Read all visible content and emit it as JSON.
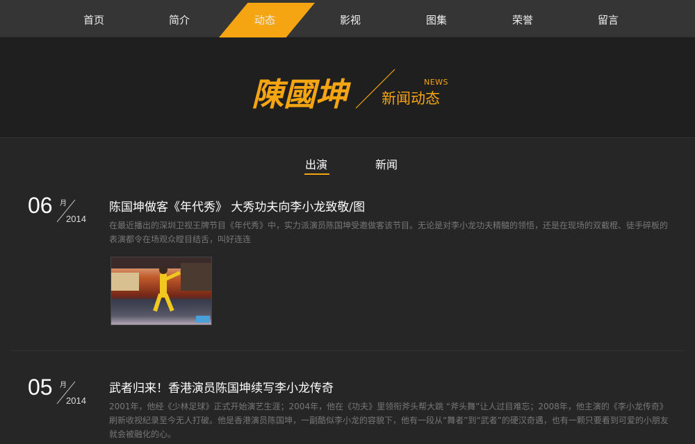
{
  "nav": {
    "items": [
      {
        "label": "首页"
      },
      {
        "label": "简介"
      },
      {
        "label": "动态",
        "active": true
      },
      {
        "label": "影视"
      },
      {
        "label": "图集"
      },
      {
        "label": "荣誉"
      },
      {
        "label": "留言"
      }
    ]
  },
  "header": {
    "logo_text": "陳國坤",
    "news_en": "NEWS",
    "news_cn": "新闻动态"
  },
  "tabs": [
    {
      "label": "出演",
      "active": true
    },
    {
      "label": "新闻",
      "active": false
    }
  ],
  "articles": [
    {
      "day": "06",
      "month_label": "月",
      "year": "2014",
      "title": "陈国坤做客《年代秀》 大秀功夫向李小龙致敬/图",
      "excerpt": "在最近播出的深圳卫视王牌节目《年代秀》中，实力派演员陈国坤受邀做客该节目。无论是对李小龙功夫精髓的领悟，还是在现场的双截棍、徒手碎板的表演都令在场观众瞠目结舌，叫好连连"
    },
    {
      "day": "05",
      "month_label": "月",
      "year": "2014",
      "title": "武者归来！香港演员陈国坤续写李小龙传奇",
      "excerpt": "2001年，他经《少林足球》正式开始演艺生涯；2004年，他在《功夫》里领衔斧头帮大跳 “斧头舞”让人过目难忘；2008年，他主演的《李小龙传奇》刷新收视纪录至今无人打破。他是香港演员陈国坤，一副酷似李小龙的容貌下，他有一段从“舞者”到“武者”的硬汉奇遇，也有一颗只要看到可爱的小朋友就会被融化的心。"
    }
  ],
  "colors": {
    "accent": "#f5a512",
    "nav_bg": "#353535",
    "header_bg": "#1f1f1f",
    "page_bg": "#262626",
    "excerpt_text": "#777777"
  }
}
